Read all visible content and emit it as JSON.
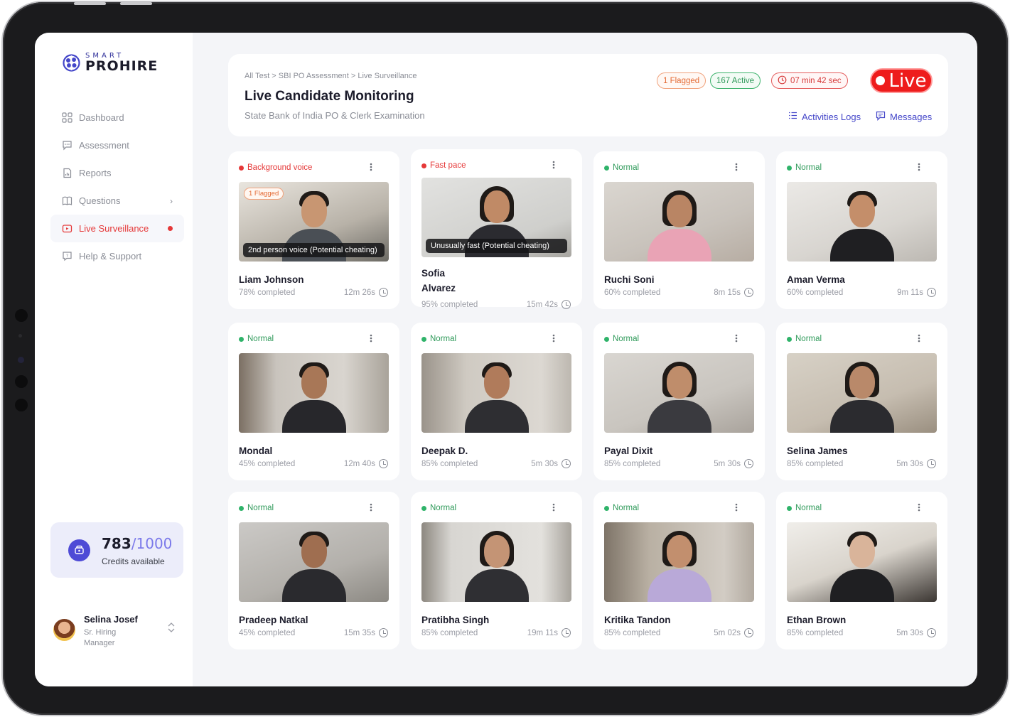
{
  "brand": {
    "small": "SMART",
    "big": "PROHIRE"
  },
  "nav": [
    {
      "label": "Dashboard",
      "icon": "grid-icon"
    },
    {
      "label": "Assessment",
      "icon": "chat-icon"
    },
    {
      "label": "Reports",
      "icon": "report-icon"
    },
    {
      "label": "Questions",
      "icon": "book-icon"
    },
    {
      "label": "Live Surveillance",
      "icon": "video-icon",
      "active": true
    },
    {
      "label": "Help & Support",
      "icon": "help-icon"
    }
  ],
  "credits": {
    "used": "783",
    "total": "/1000",
    "label": "Credits available"
  },
  "user": {
    "name": "Selina Josef",
    "role": "Sr. Hiring Manager"
  },
  "header": {
    "breadcrumb": "All Test > SBI PO Assessment > Live Surveillance",
    "title": "Live Candidate Monitoring",
    "subtitle": "State Bank of India PO & Clerk Examination",
    "flagged": "1 Flagged",
    "active": "167 Active",
    "timer": "07 min 42 sec",
    "live": "Live",
    "logs": "Activities Logs",
    "messages": "Messages"
  },
  "candidates": [
    {
      "name": "Liam Johnson",
      "status": "Background voice",
      "alert": true,
      "progress": "78% completed",
      "time": "12m 26s",
      "badge": "1 Flagged",
      "overlay": "2nd person voice (Potential cheating)"
    },
    {
      "name": "Sofia Alvarez",
      "status": "Fast pace",
      "alert": true,
      "progress": "95% completed",
      "time": "15m 42s",
      "badge": "",
      "overlay": "Unusually fast (Potential cheating)"
    },
    {
      "name": "Ruchi Soni",
      "status": "Normal",
      "alert": false,
      "progress": "60% completed",
      "time": "8m 15s"
    },
    {
      "name": "Aman Verma",
      "status": "Normal",
      "alert": false,
      "progress": "60% completed",
      "time": "9m 11s"
    },
    {
      "name": "Mondal",
      "status": "Normal",
      "alert": false,
      "progress": "45% completed",
      "time": "12m 40s"
    },
    {
      "name": "Deepak D.",
      "status": "Normal",
      "alert": false,
      "progress": "85% completed",
      "time": "5m 30s"
    },
    {
      "name": "Payal Dixit",
      "status": "Normal",
      "alert": false,
      "progress": "85% completed",
      "time": "5m 30s"
    },
    {
      "name": "Selina James",
      "status": "Normal",
      "alert": false,
      "progress": "85% completed",
      "time": "5m 30s"
    },
    {
      "name": "Pradeep Natkal",
      "status": "Normal",
      "alert": false,
      "progress": "45% completed",
      "time": "15m 35s"
    },
    {
      "name": "Pratibha Singh",
      "status": "Normal",
      "alert": false,
      "progress": "85% completed",
      "time": "19m 11s"
    },
    {
      "name": "Kritika Tandon",
      "status": "Normal",
      "alert": false,
      "progress": "85% completed",
      "time": "5m 02s"
    },
    {
      "name": "Ethan Brown",
      "status": "Normal",
      "alert": false,
      "progress": "85% completed",
      "time": "5m 30s"
    }
  ],
  "colors": {
    "accent": "#4446c9",
    "alert": "#e53838",
    "ok": "#2fb36a",
    "live": "#ee1c1c"
  }
}
